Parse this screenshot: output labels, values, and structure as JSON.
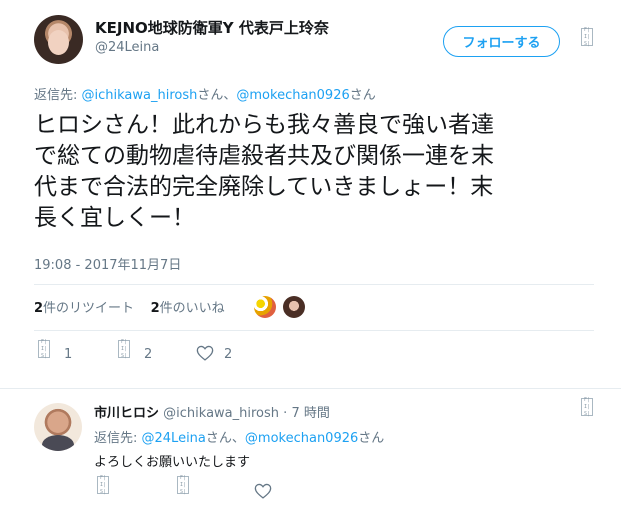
{
  "tweet": {
    "display_name": "KEJNO地球防衛軍Y 代表戸上玲奈",
    "handle": "@24Leina",
    "follow_label": "フォローする",
    "reply_to_prefix": "返信先: ",
    "reply_to_user1": "@ichikawa_hirosh",
    "reply_to_sep": "さん、",
    "reply_to_user2": "@mokechan0926",
    "reply_to_suffix": "さん",
    "text_line1": "ヒロシさん！此れからも我々善良で強い者達",
    "text_line2": "で総ての動物虐待虐殺者共及び関係一連を末",
    "text_line3": "代まで合法的完全廃除していきましょー！末",
    "text_line4": "長く宜しくー！",
    "timestamp": "19:08 - 2017年11月7日",
    "retweets_count": "2",
    "retweets_label": "件のリツイート",
    "likes_count": "2",
    "likes_label": "件のいいね",
    "actions": {
      "reply_count": "1",
      "retweet_count": "2",
      "like_count": "2"
    }
  },
  "reply": {
    "display_name": "市川ヒロシ",
    "handle": "@ichikawa_hirosh",
    "separator": "·",
    "time": "7 時間",
    "reply_to_prefix": "返信先: ",
    "reply_to_user1": "@24Leina",
    "reply_to_sep": "さん、",
    "reply_to_user2": "@mokechan0926",
    "reply_to_suffix": "さん",
    "text": "よろしくお願いいたします"
  },
  "placeholder_chip": {
    "line1": "F|S",
    "line2": "I|S",
    "line3": "S|E"
  },
  "colors": {
    "link": "#1da1f2",
    "muted": "#657786",
    "text": "#14171a"
  }
}
